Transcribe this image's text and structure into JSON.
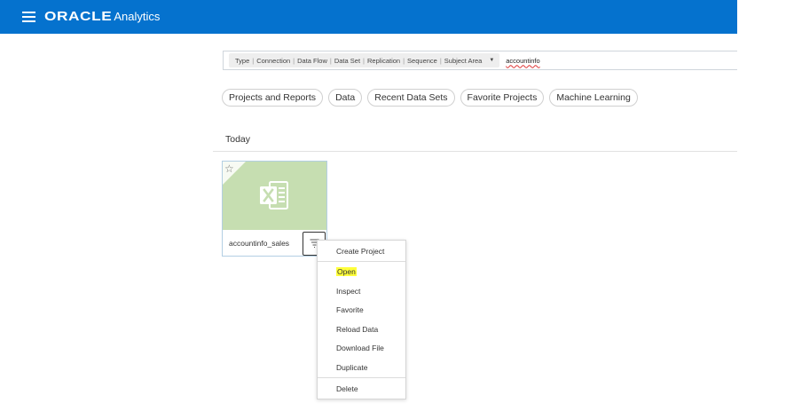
{
  "header": {
    "logo_text": "ORACLE",
    "product_name": "Analytics"
  },
  "search": {
    "type_label": "Type",
    "type_filters": [
      "Connection",
      "Data Flow",
      "Data Set",
      "Replication",
      "Sequence",
      "Subject Area"
    ],
    "query": "accountinfo"
  },
  "chips": [
    "Projects and Reports",
    "Data",
    "Recent Data Sets",
    "Favorite Projects",
    "Machine Learning"
  ],
  "section": {
    "title": "Today"
  },
  "card": {
    "name": "accountinfo_sales",
    "icon": "excel-icon",
    "thumb_color": "#c6deb1"
  },
  "context_menu": {
    "items": [
      "Create Project",
      "Open",
      "Inspect",
      "Favorite",
      "Reload Data",
      "Download File",
      "Duplicate",
      "Delete"
    ],
    "highlighted": "Open",
    "highlight_color": "#ffff3a"
  },
  "colors": {
    "header_bg": "#0572ce"
  }
}
